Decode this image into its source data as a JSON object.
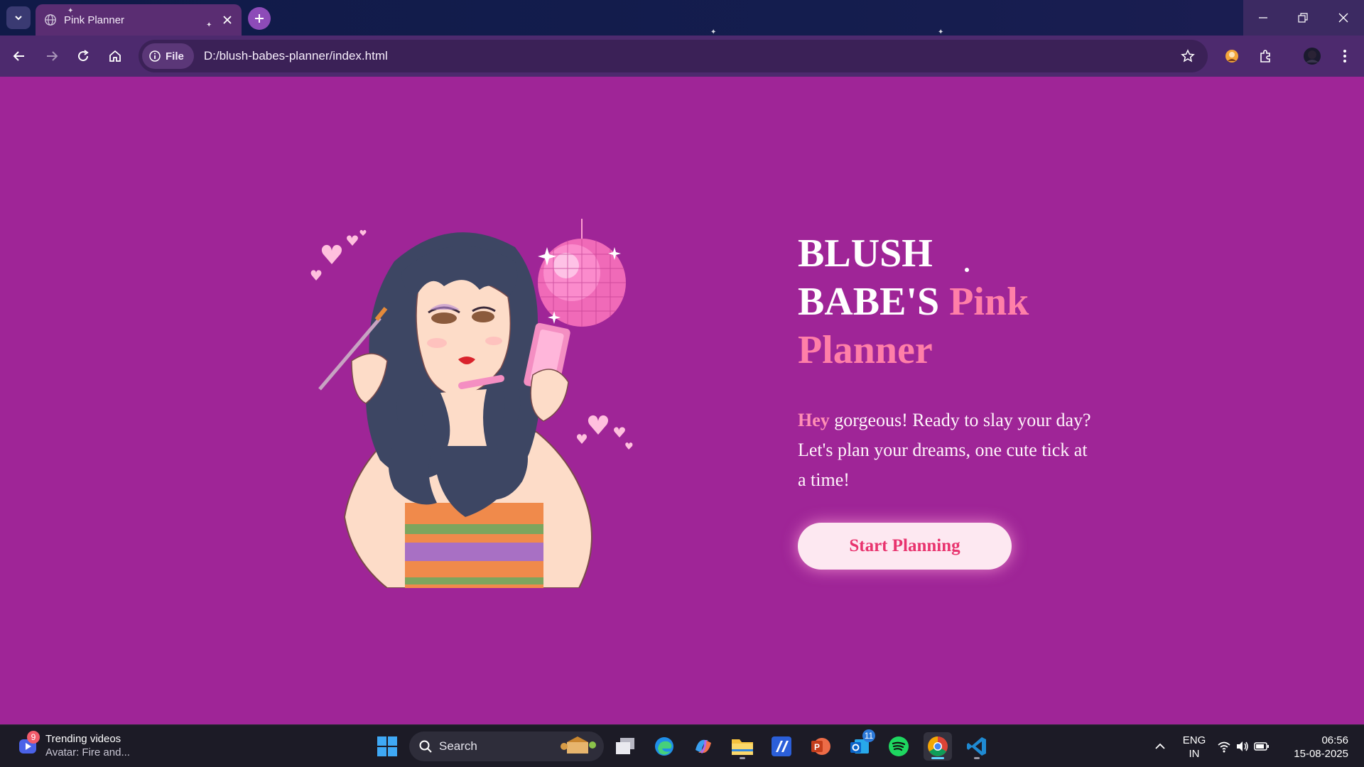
{
  "browser": {
    "tab_title": "Pink Planner",
    "file_chip_label": "File",
    "url": "D:/blush-babes-planner/index.html"
  },
  "hero": {
    "title_line1": "BLUSH",
    "title_line2_white": "BABE'S",
    "title_line2_pink": "Pink",
    "title_line3_pink": "Planner",
    "subtitle_hey": "Hey",
    "subtitle_rest": "gorgeous! Ready to slay your day? Let's plan your dreams, one cute tick at a time!",
    "cta_label": "Start Planning"
  },
  "colors": {
    "page_background": "#9f2597",
    "title_pink": "#ff7fa8",
    "button_background": "#fde8f1",
    "button_text": "#e8336e"
  },
  "taskbar": {
    "widget_badge": "9",
    "widget_title": "Trending videos",
    "widget_subtitle": "Avatar: Fire and...",
    "search_placeholder": "Search",
    "outlook_badge": "11",
    "language_line1": "ENG",
    "language_line2": "IN",
    "time": "06:56",
    "date": "15-08-2025"
  },
  "icons": [
    "tab-list-icon",
    "globe-icon",
    "close-icon",
    "plus-icon",
    "minimize-icon",
    "restore-icon",
    "back-icon",
    "forward-icon",
    "reload-icon",
    "home-icon",
    "info-icon",
    "star-icon",
    "extensions-icon",
    "profile-avatar",
    "menu-icon",
    "windows-start-icon",
    "search-icon",
    "task-view-icon",
    "edge-icon",
    "copilot-icon",
    "file-explorer-icon",
    "app-icon",
    "powerpoint-icon",
    "outlook-icon",
    "spotify-icon",
    "chrome-icon",
    "vscode-icon",
    "chevron-up-icon",
    "wifi-icon",
    "volume-icon",
    "battery-icon"
  ]
}
